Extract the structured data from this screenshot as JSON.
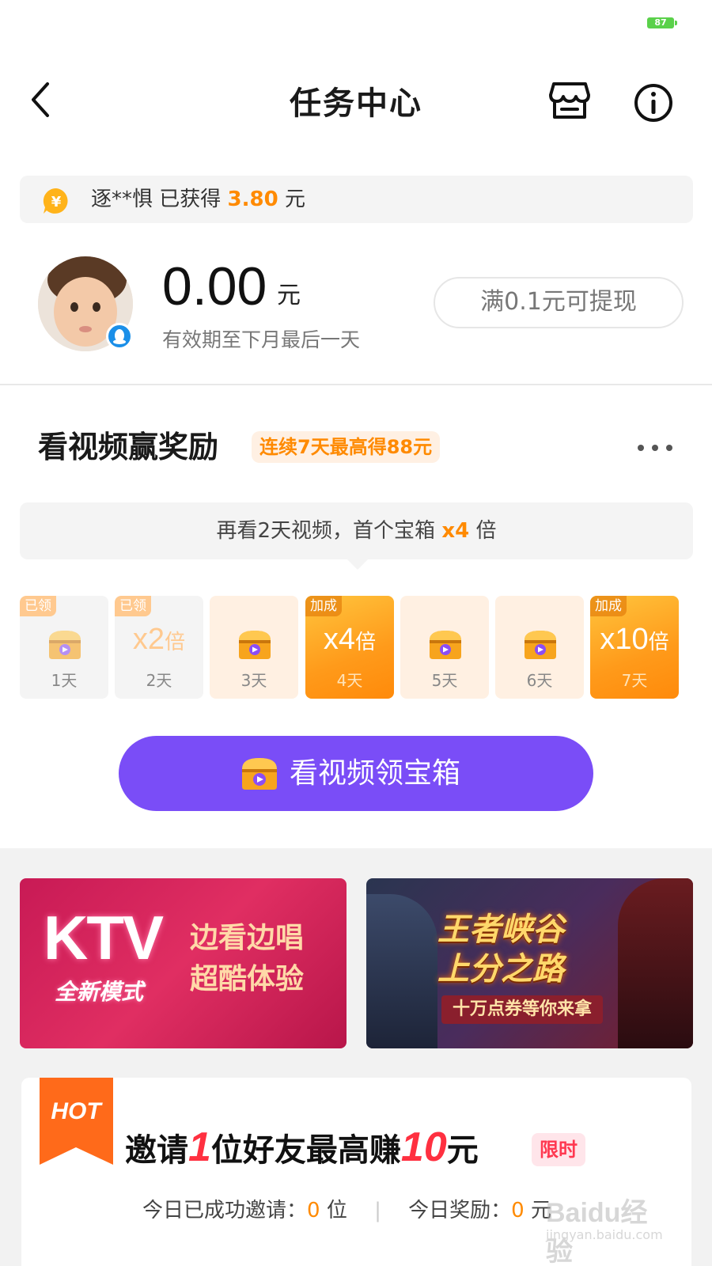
{
  "status_bar": {
    "battery": "87"
  },
  "nav": {
    "title": "任务中心"
  },
  "ticker": {
    "user": "逐**惧 已获得",
    "amount": "3.80",
    "unit": "元"
  },
  "wallet": {
    "balance": "0.00",
    "unit": "元",
    "expire_text": "有效期至下月最后一天",
    "withdraw_label": "满0.1元可提现"
  },
  "video_section": {
    "title": "看视频赢奖励",
    "badge": "连续7天最高得88元",
    "tip_prefix": "再看2天视频，首个宝箱",
    "tip_highlight": "x4",
    "tip_suffix": "倍",
    "days": [
      {
        "label": "1天",
        "state": "claimed",
        "tag": "已领",
        "mult": "",
        "mult_unit": ""
      },
      {
        "label": "2天",
        "state": "claimed",
        "tag": "已领",
        "mult": "x2",
        "mult_unit": "倍"
      },
      {
        "label": "3天",
        "state": "pending",
        "tag": "",
        "mult": "",
        "mult_unit": ""
      },
      {
        "label": "4天",
        "state": "boost",
        "tag": "加成",
        "mult": "x4",
        "mult_unit": "倍"
      },
      {
        "label": "5天",
        "state": "pending",
        "tag": "",
        "mult": "",
        "mult_unit": ""
      },
      {
        "label": "6天",
        "state": "pending",
        "tag": "",
        "mult": "",
        "mult_unit": ""
      },
      {
        "label": "7天",
        "state": "boost",
        "tag": "加成",
        "mult": "x10",
        "mult_unit": "倍"
      }
    ],
    "button_label": "看视频领宝箱"
  },
  "banners": {
    "ktv": {
      "logo_big": "KTV",
      "logo_small": "全新模式",
      "line1": "边看边唱",
      "line2": "超酷体验"
    },
    "game": {
      "line1": "王者峡谷",
      "line2": "上分之路",
      "sub": "十万点券等你来拿"
    }
  },
  "invite": {
    "hot_label": "HOT",
    "title_a": "邀请",
    "title_num1": "1",
    "title_b": "位好友最高赚",
    "title_num2": "10",
    "title_c": "元",
    "limit_badge": "限时",
    "stats_prefix1": "今日已成功邀请：",
    "stats_val1": "0",
    "stats_unit1": "位",
    "stats_sep": "|",
    "stats_prefix2": "今日奖励：",
    "stats_val2": "0",
    "stats_unit2": "元"
  },
  "watermark": {
    "logo": "Baidu经验",
    "url": "jingyan.baidu.com"
  },
  "colors": {
    "accent_orange": "#ff8a00",
    "button_purple": "#7a4df7",
    "hot_red": "#ff3040"
  }
}
